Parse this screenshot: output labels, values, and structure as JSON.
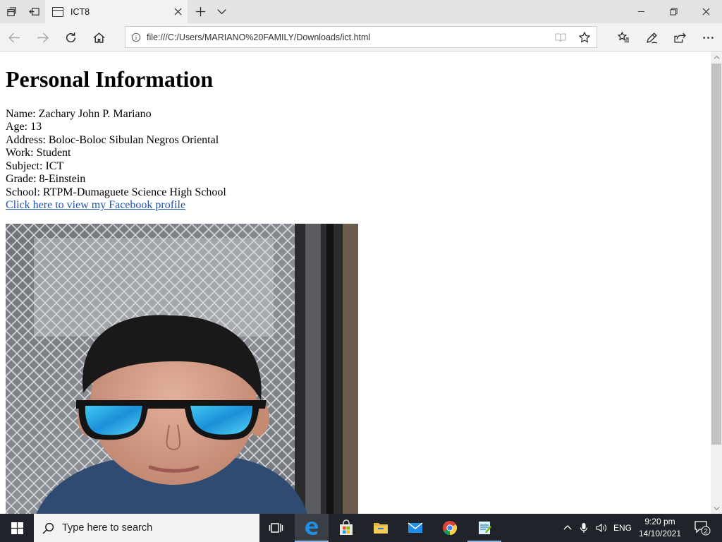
{
  "browser": {
    "tab_title": "ICT8",
    "url": "file:///C:/Users/MARIANO%20FAMILY/Downloads/ict.html"
  },
  "page": {
    "heading": "Personal Information",
    "lines": [
      "Name: Zachary John P. Mariano",
      "Age: 13",
      "Address: Boloc-Boloc Sibulan Negros Oriental",
      "Work: Student",
      "Subject: ICT",
      "Grade: 8-Einstein",
      "School: RTPM-Dumaguete Science High School"
    ],
    "link_text": "Click here to view my Facebook profile"
  },
  "taskbar": {
    "search_placeholder": "Type here to search",
    "language": "ENG",
    "time": "9:20 pm",
    "date": "14/10/2021",
    "notification_count": "2"
  },
  "colors": {
    "link": "#2255aa",
    "tabstrip": "#e4e2e4",
    "taskbar": "#20242a"
  },
  "icons": {
    "set_aside": "tabs-aside-icon",
    "show_aside": "tabs-restore-icon",
    "tab": "page-icon",
    "close_tab": "close-icon",
    "new_tab": "plus-icon",
    "tab_list": "chevron-down-icon",
    "back": "back-arrow-icon",
    "forward": "forward-arrow-icon",
    "refresh": "refresh-icon",
    "home": "home-icon",
    "site_info": "info-icon",
    "reading_view": "book-icon",
    "favorite": "star-icon",
    "favorites_hub": "favorites-list-icon",
    "notes": "pen-icon",
    "share": "share-icon",
    "more": "ellipsis-icon"
  }
}
